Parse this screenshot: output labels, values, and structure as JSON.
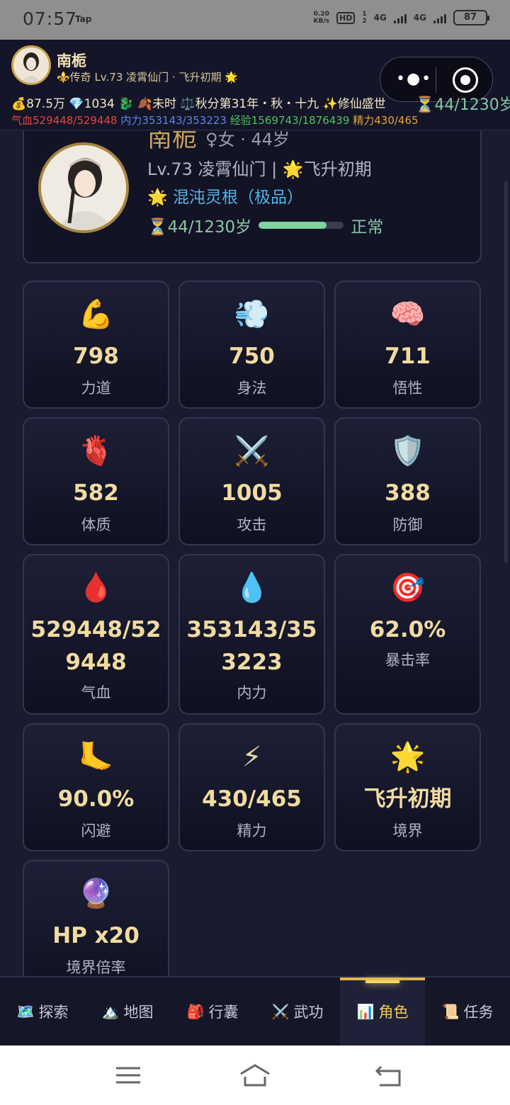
{
  "status_bar": {
    "time": "07:57",
    "app_label": "Tap",
    "net_speed_value": "0.20",
    "net_speed_unit": "KB/s",
    "hd_label": "HD",
    "sim1": "1",
    "sim2": "2",
    "net1": "4G",
    "net2": "4G",
    "battery": "87"
  },
  "header": {
    "name": "南栀",
    "rank_line": "⚜️传奇 Lv.73 凌霄仙门 · 飞升初期 🌟",
    "resources": "💰87.5万 💎1034 🐉 🍂未时 ⚖️秋分第31年・秋・十九 ✨修仙盛世",
    "life": "⏳44/1230岁",
    "hp_label": "气血",
    "hp_value": "529448/529448",
    "mp_label": "内力",
    "mp_value": "353143/353223",
    "exp_label": "经验",
    "exp_value": "1569743/1876439",
    "energy_label": "精力",
    "energy_value": "430/465"
  },
  "profile": {
    "name": "南栀",
    "gender_age": "♀女 · 44岁",
    "level_line": "Lv.73 凌霄仙门 | 🌟飞升初期",
    "root": "🌟 混沌灵根（极品）",
    "life": "⏳44/1230岁",
    "life_fraction": 0.8,
    "status": "正常"
  },
  "stats": [
    {
      "icon": "💪",
      "value": "798",
      "label": "力道"
    },
    {
      "icon": "💨",
      "value": "750",
      "label": "身法"
    },
    {
      "icon": "🧠",
      "value": "711",
      "label": "悟性"
    },
    {
      "icon": "🫀",
      "value": "582",
      "label": "体质"
    },
    {
      "icon": "⚔️",
      "value": "1005",
      "label": "攻击"
    },
    {
      "icon": "🛡️",
      "value": "388",
      "label": "防御"
    },
    {
      "icon": "🩸",
      "value_line1": "529448/52",
      "value_line2": "9448",
      "label": "气血"
    },
    {
      "icon": "💧",
      "value_line1": "353143/35",
      "value_line2": "3223",
      "label": "内力"
    },
    {
      "icon": "🎯",
      "value": "62.0%",
      "label": "暴击率"
    },
    {
      "icon": "🦶",
      "value": "90.0%",
      "label": "闪避"
    },
    {
      "icon": "⚡",
      "value": "430/465",
      "label": "精力"
    },
    {
      "icon": "🌟",
      "value": "飞升初期",
      "label": "境界"
    },
    {
      "icon": "🔮",
      "value": "HP x20",
      "label": "境界倍率"
    }
  ],
  "nav": [
    {
      "icon": "🗺️",
      "label": "探索"
    },
    {
      "icon": "🏔️",
      "label": "地图"
    },
    {
      "icon": "🎒",
      "label": "行囊"
    },
    {
      "icon": "⚔️",
      "label": "武功"
    },
    {
      "icon": "📊",
      "label": "角色",
      "active": true
    },
    {
      "icon": "📜",
      "label": "任务"
    }
  ],
  "colors": {
    "background": "#1a1b2e",
    "accent_gold": "#f1c95a",
    "hp_red": "#e4463a",
    "mp_blue": "#5c86e8",
    "exp_green": "#4cc35a",
    "energy_orange": "#e4a23a",
    "life_green": "#86c7a2"
  }
}
